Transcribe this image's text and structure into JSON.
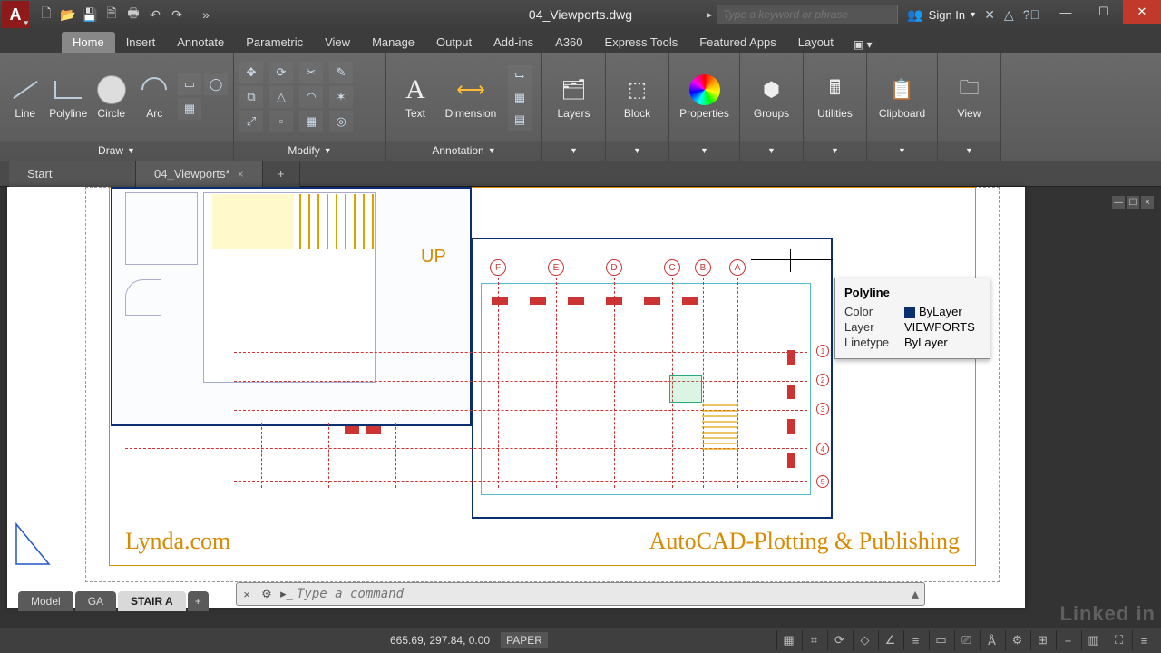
{
  "app": {
    "letter": "A",
    "title": "04_Viewports.dwg"
  },
  "search": {
    "placeholder": "Type a keyword or phrase"
  },
  "signin": {
    "label": "Sign In"
  },
  "tabs": [
    "Home",
    "Insert",
    "Annotate",
    "Parametric",
    "View",
    "Manage",
    "Output",
    "Add-ins",
    "A360",
    "Express Tools",
    "Featured Apps",
    "Layout"
  ],
  "ribbon": {
    "draw": {
      "title": "Draw",
      "line": "Line",
      "polyline": "Polyline",
      "circle": "Circle",
      "arc": "Arc"
    },
    "modify": {
      "title": "Modify"
    },
    "annotation": {
      "title": "Annotation",
      "text": "Text",
      "dimension": "Dimension"
    },
    "layers": "Layers",
    "block": "Block",
    "properties": "Properties",
    "groups": "Groups",
    "utilities": "Utilities",
    "clipboard": "Clipboard",
    "view": "View"
  },
  "filetabs": {
    "start": "Start",
    "file": "04_Viewports*"
  },
  "drawing": {
    "up": "UP",
    "brand_left": "Lynda.com",
    "brand_right": "AutoCAD-Plotting & Publishing",
    "grid_letters": [
      "F",
      "E",
      "D",
      "C",
      "B",
      "A"
    ],
    "grid_nums": [
      "1",
      "2",
      "3",
      "4",
      "5"
    ]
  },
  "tooltip": {
    "title": "Polyline",
    "color_k": "Color",
    "color_v": "ByLayer",
    "layer_k": "Layer",
    "layer_v": "VIEWPORTS",
    "lt_k": "Linetype",
    "lt_v": "ByLayer"
  },
  "cmd": {
    "placeholder": "Type a command"
  },
  "layouts": {
    "model": "Model",
    "ga": "GA",
    "stair": "STAIR A"
  },
  "status": {
    "coords": "665.69, 297.84, 0.00",
    "space": "PAPER"
  },
  "watermark": "Linked in"
}
